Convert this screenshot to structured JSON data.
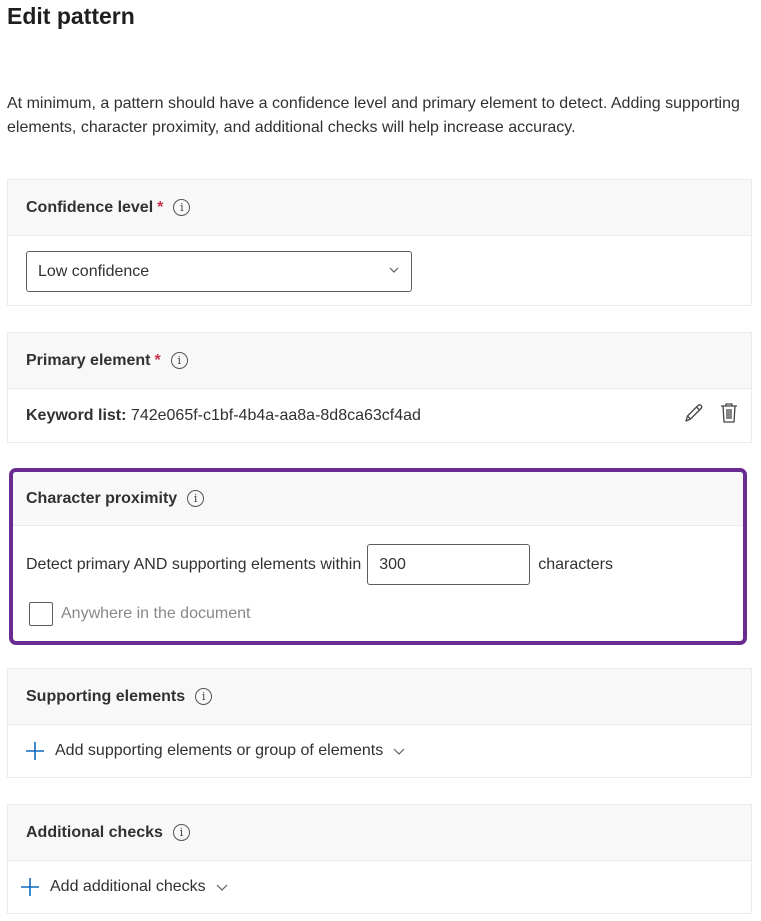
{
  "page": {
    "title": "Edit pattern",
    "intro": "At minimum, a pattern should have a confidence level and primary element to detect. Adding supporting elements, character proximity, and additional checks will help increase accuracy."
  },
  "confidence": {
    "title": "Confidence level",
    "required_mark": "*",
    "selected": "Low confidence"
  },
  "primary": {
    "title": "Primary element",
    "required_mark": "*",
    "keyword_label": "Keyword list:",
    "keyword_value": "742e065f-c1bf-4b4a-aa8a-8d8ca63cf4ad"
  },
  "proximity": {
    "title": "Character proximity",
    "detect_label": "Detect primary AND supporting elements within",
    "value": "300",
    "unit": "characters",
    "anywhere_label": "Anywhere in the document",
    "anywhere_checked": false,
    "highlight_color": "#6a2c91"
  },
  "supporting": {
    "title": "Supporting elements",
    "add_label": "Add supporting elements or group of elements"
  },
  "checks": {
    "title": "Additional checks",
    "add_label": "Add additional checks"
  },
  "icons": {
    "info": "info-icon",
    "edit": "pencil-icon",
    "delete": "trash-icon",
    "add": "plus-icon",
    "dropdown": "chevron-down-icon"
  },
  "colors": {
    "required": "#c4314b",
    "accent": "#0f6cbd",
    "header_bg": "#f8f8f8"
  }
}
